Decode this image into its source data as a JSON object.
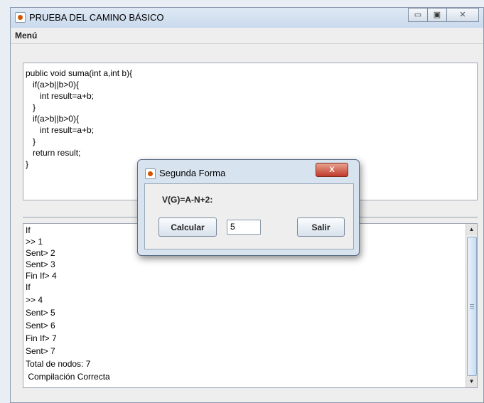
{
  "window": {
    "title": "PRUEBA DEL CAMINO BÁSICO",
    "minimize_label": "▭",
    "maximize_label": "▣",
    "close_label": "✕"
  },
  "menubar": {
    "menu_label": "Menú"
  },
  "code_area": {
    "lines": [
      "public void suma(int a,int b){",
      "   if(a>b||b>0){",
      "      int result=a+b;",
      "   }",
      "   if(a>b||b>0){",
      "      int result=a+b;",
      "   }",
      "   return result;",
      "}"
    ]
  },
  "output_area": {
    "lines": [
      "If",
      ">> 1",
      "Sent> 2",
      "Sent> 3",
      "Fin If> 4",
      "If",
      ">> 4",
      "Sent> 5",
      "Sent> 6",
      "Fin If> 7",
      "Sent> 7",
      "Total de nodos: 7",
      " Compilación Correcta"
    ]
  },
  "dialog": {
    "title": "Segunda Forma",
    "close_label": "X",
    "formula_label": "V(G)=A-N+2:",
    "calc_button": "Calcular",
    "result_value": "5",
    "exit_button": "Salir"
  },
  "icons": {
    "app": "java-coffee-icon",
    "scroll_up": "triangle-up-icon",
    "scroll_down": "triangle-down-icon"
  }
}
